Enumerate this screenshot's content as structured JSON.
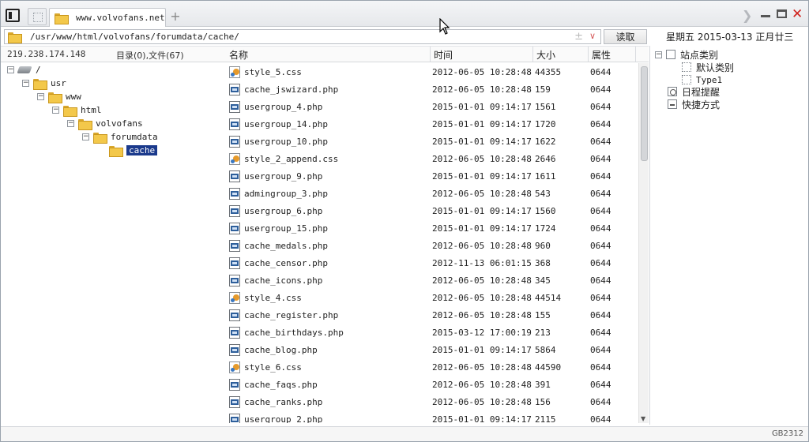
{
  "titlebar": {
    "tab_label": "www.volvofans.net",
    "newtab_label": "+"
  },
  "address": {
    "path": "/usr/www/html/volvofans/forumdata/cache/",
    "plus_glyph": "±",
    "read_button": "读取"
  },
  "dateinfo": "星期五 2015-03-13 正月廿三",
  "info": {
    "ip": "219.238.174.148",
    "dircount": "目录(0),文件(67)"
  },
  "columns": {
    "name": "名称",
    "time": "时间",
    "size": "大小",
    "attr": "属性"
  },
  "tree": [
    {
      "label": "/",
      "type": "drive",
      "selected": false
    },
    {
      "label": "usr",
      "type": "folder",
      "selected": false
    },
    {
      "label": "www",
      "type": "folder",
      "selected": false
    },
    {
      "label": "html",
      "type": "folder",
      "selected": false
    },
    {
      "label": "volvofans",
      "type": "folder",
      "selected": false
    },
    {
      "label": "forumdata",
      "type": "folder",
      "selected": false
    },
    {
      "label": "cache",
      "type": "folder",
      "selected": true
    }
  ],
  "files": [
    {
      "name": "style_5.css",
      "kind": "css",
      "time": "2012-06-05 10:28:48",
      "size": "44355",
      "attr": "0644"
    },
    {
      "name": "cache_jswizard.php",
      "kind": "php",
      "time": "2012-06-05 10:28:48",
      "size": "159",
      "attr": "0644"
    },
    {
      "name": "usergroup_4.php",
      "kind": "php",
      "time": "2015-01-01 09:14:17",
      "size": "1561",
      "attr": "0644"
    },
    {
      "name": "usergroup_14.php",
      "kind": "php",
      "time": "2015-01-01 09:14:17",
      "size": "1720",
      "attr": "0644"
    },
    {
      "name": "usergroup_10.php",
      "kind": "php",
      "time": "2015-01-01 09:14:17",
      "size": "1622",
      "attr": "0644"
    },
    {
      "name": "style_2_append.css",
      "kind": "css",
      "time": "2012-06-05 10:28:48",
      "size": "2646",
      "attr": "0644"
    },
    {
      "name": "usergroup_9.php",
      "kind": "php",
      "time": "2015-01-01 09:14:17",
      "size": "1611",
      "attr": "0644"
    },
    {
      "name": "admingroup_3.php",
      "kind": "php",
      "time": "2012-06-05 10:28:48",
      "size": "543",
      "attr": "0644"
    },
    {
      "name": "usergroup_6.php",
      "kind": "php",
      "time": "2015-01-01 09:14:17",
      "size": "1560",
      "attr": "0644"
    },
    {
      "name": "usergroup_15.php",
      "kind": "php",
      "time": "2015-01-01 09:14:17",
      "size": "1724",
      "attr": "0644"
    },
    {
      "name": "cache_medals.php",
      "kind": "php",
      "time": "2012-06-05 10:28:48",
      "size": "960",
      "attr": "0644"
    },
    {
      "name": "cache_censor.php",
      "kind": "php",
      "time": "2012-11-13 06:01:15",
      "size": "368",
      "attr": "0644"
    },
    {
      "name": "cache_icons.php",
      "kind": "php",
      "time": "2012-06-05 10:28:48",
      "size": "345",
      "attr": "0644"
    },
    {
      "name": "style_4.css",
      "kind": "css",
      "time": "2012-06-05 10:28:48",
      "size": "44514",
      "attr": "0644"
    },
    {
      "name": "cache_register.php",
      "kind": "php",
      "time": "2012-06-05 10:28:48",
      "size": "155",
      "attr": "0644"
    },
    {
      "name": "cache_birthdays.php",
      "kind": "php",
      "time": "2015-03-12 17:00:19",
      "size": "213",
      "attr": "0644"
    },
    {
      "name": "cache_blog.php",
      "kind": "php",
      "time": "2015-01-01 09:14:17",
      "size": "5864",
      "attr": "0644"
    },
    {
      "name": "style_6.css",
      "kind": "css",
      "time": "2012-06-05 10:28:48",
      "size": "44590",
      "attr": "0644"
    },
    {
      "name": "cache_faqs.php",
      "kind": "php",
      "time": "2012-06-05 10:28:48",
      "size": "391",
      "attr": "0644"
    },
    {
      "name": "cache_ranks.php",
      "kind": "php",
      "time": "2012-06-05 10:28:48",
      "size": "156",
      "attr": "0644"
    },
    {
      "name": "usergroup_2.php",
      "kind": "php",
      "time": "2015-01-01 09:14:17",
      "size": "2115",
      "attr": "0644"
    }
  ],
  "rightpanel": {
    "site_category": "站点类别",
    "default_category": "默认类别",
    "type1": "Type1",
    "schedule": "日程提醒",
    "shortcut": "快捷方式"
  },
  "status": {
    "encoding": "GB2312"
  },
  "colors": {
    "selection": "#1b3a8c",
    "close": "#d0211c",
    "folder": "#f3c84a"
  }
}
